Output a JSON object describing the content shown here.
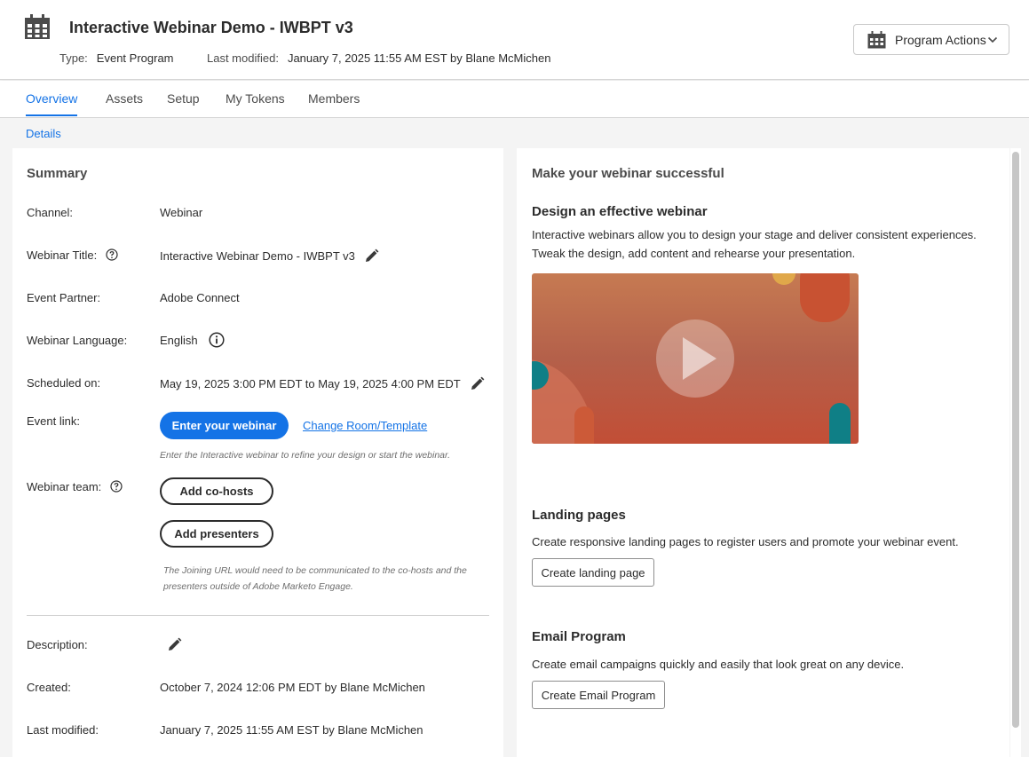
{
  "header": {
    "title": "Interactive Webinar Demo - IWBPT v3",
    "type_label": "Type:",
    "type_value": "Event Program",
    "modified_label": "Last modified:",
    "modified_value": "January 7, 2025 11:55 AM EST by Blane McMichen",
    "actions_label": "Program Actions",
    "program_icon": "calendar-icon"
  },
  "tabs": [
    {
      "label": "Overview",
      "active": true
    },
    {
      "label": "Assets",
      "active": false
    },
    {
      "label": "Setup",
      "active": false
    },
    {
      "label": "My Tokens",
      "active": false
    },
    {
      "label": "Members",
      "active": false
    }
  ],
  "sub_nav": {
    "details": "Details"
  },
  "summary": {
    "heading": "Summary",
    "channel_label": "Channel:",
    "channel_value": "Webinar",
    "title_label": "Webinar Title:",
    "title_value": "Interactive Webinar Demo - IWBPT v3",
    "partner_label": "Event Partner:",
    "partner_value": "Adobe Connect",
    "language_label": "Webinar Language:",
    "language_value": "English",
    "scheduled_label": "Scheduled on:",
    "scheduled_value": "May 19, 2025 3:00 PM EDT to May 19, 2025 4:00 PM EDT",
    "event_link_label": "Event link:",
    "enter_button": "Enter your webinar",
    "change_room_link": "Change Room/Template",
    "enter_hint": "Enter the Interactive webinar to refine your design or start the webinar.",
    "team_label": "Webinar team:",
    "add_cohosts": "Add co-hosts",
    "add_presenters": "Add presenters",
    "team_hint_1": "The Joining URL would need to be communicated to the co-hosts and the",
    "team_hint_2": "presenters outside of Adobe Marketo Engage.",
    "description_label": "Description:",
    "created_label": "Created:",
    "created_value": "October 7, 2024 12:06 PM EDT by Blane McMichen",
    "last_modified_label": "Last modified:",
    "last_modified_value": "January 7, 2025 11:55 AM EST by Blane McMichen"
  },
  "right": {
    "heading": "Make your webinar successful",
    "design_title": "Design an effective webinar",
    "design_text_1": "Interactive webinars allow you to design your stage and deliver consistent experiences.",
    "design_text_2": "Tweak the design, add content and rehearse your presentation.",
    "landing_title": "Landing pages",
    "landing_text": "Create responsive landing pages to register users and promote your webinar event.",
    "landing_button": "Create landing page",
    "email_title": "Email Program",
    "email_text": "Create email campaigns quickly and easily that look great on any device.",
    "email_button": "Create Email Program"
  },
  "colors": {
    "accent": "#1473e6",
    "video_bg": "#b85f48",
    "video_teal": "#0f7f86"
  }
}
